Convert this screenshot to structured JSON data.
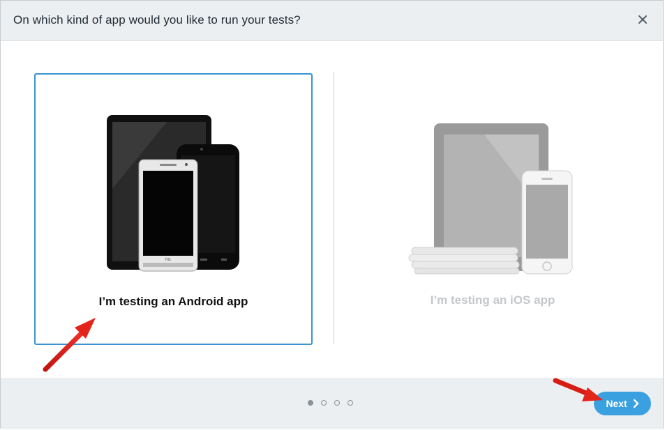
{
  "dialog": {
    "title": "On which kind of app would you like to run your tests?",
    "close_icon": "close-icon"
  },
  "options": [
    {
      "label": "I’m testing an Android app",
      "selected": true,
      "icon": "android-devices-icon"
    },
    {
      "label": "I’m testing an iOS app",
      "selected": false,
      "icon": "ios-devices-icon"
    }
  ],
  "pagination": {
    "total": 4,
    "current": 1
  },
  "footer": {
    "next_label": "Next",
    "next_icon": "chevron-right-icon"
  },
  "colors": {
    "accent": "#3aa0e0",
    "selection_border": "#3a93d0",
    "annotation_arrow": "#e3241b"
  }
}
